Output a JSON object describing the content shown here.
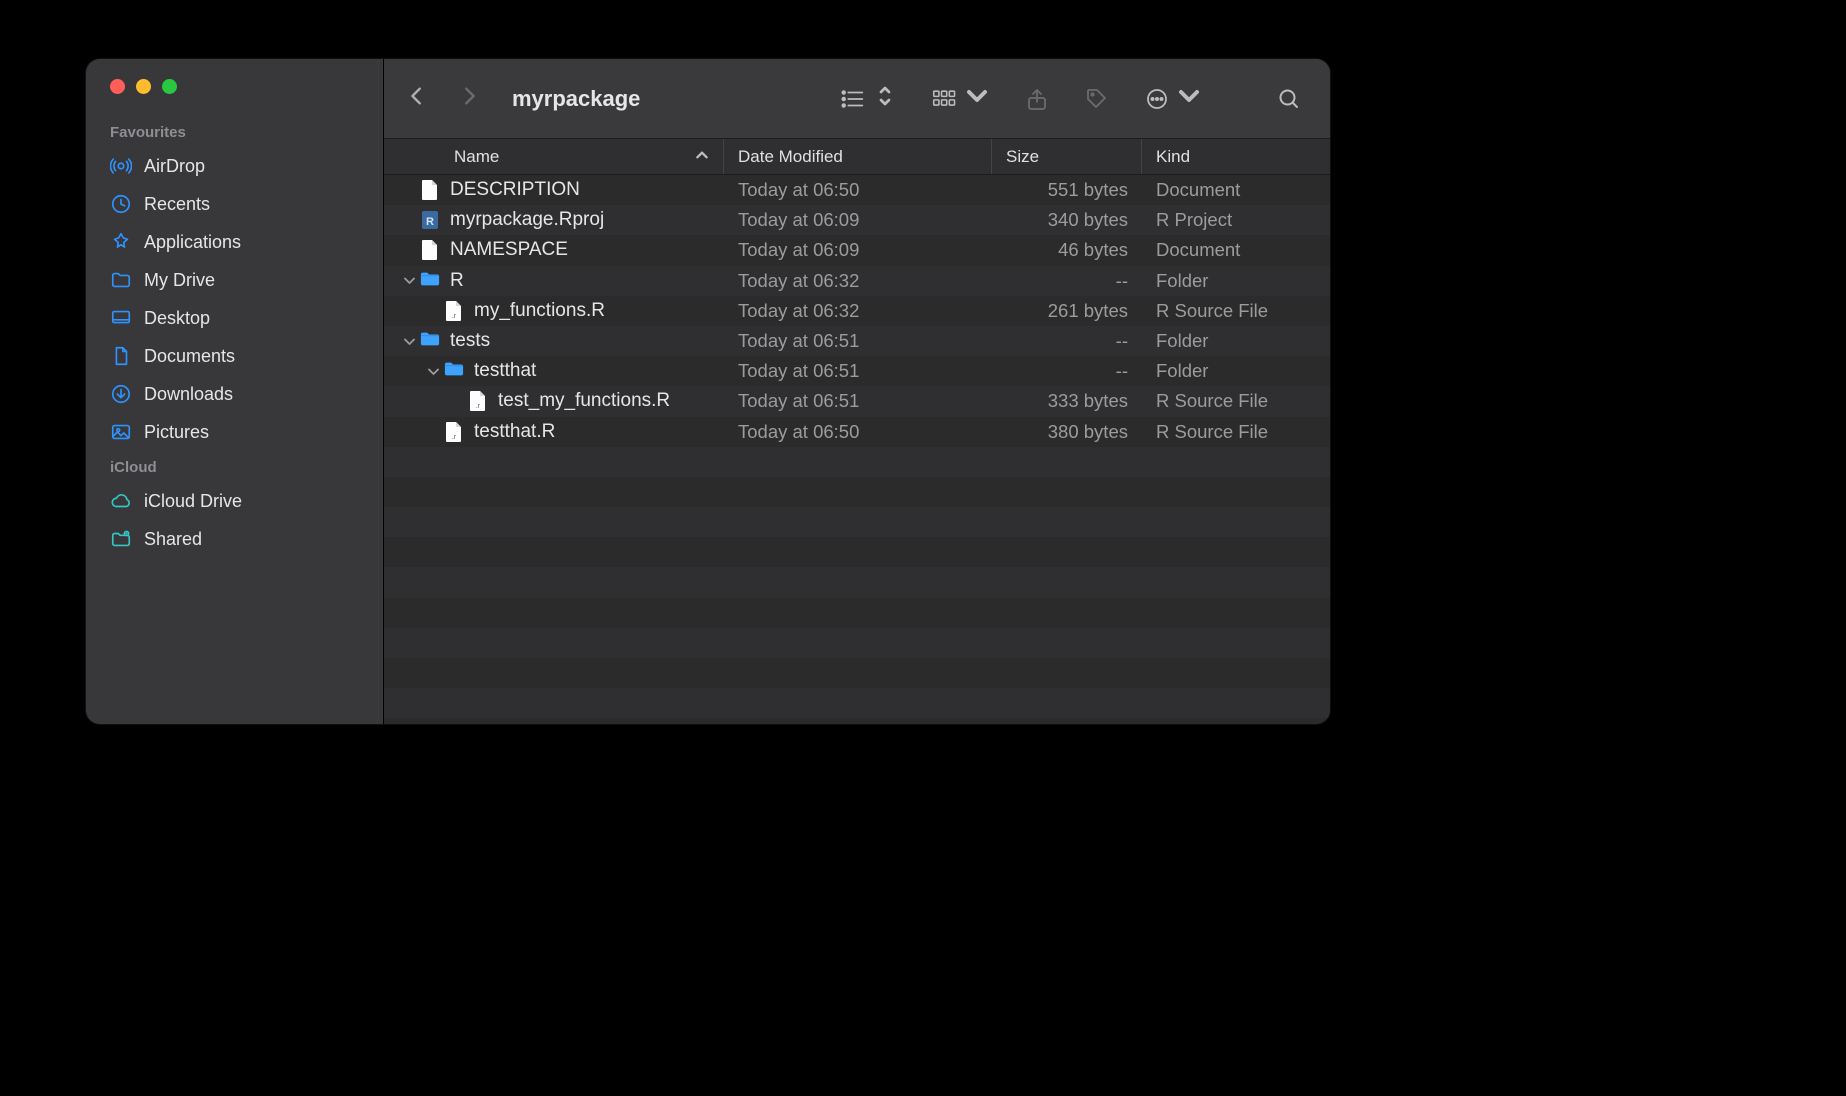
{
  "window": {
    "title": "myrpackage"
  },
  "sidebar": {
    "sections": [
      {
        "title": "Favourites",
        "items": [
          {
            "label": "AirDrop",
            "icon": "airdrop"
          },
          {
            "label": "Recents",
            "icon": "clock"
          },
          {
            "label": "Applications",
            "icon": "apps"
          },
          {
            "label": "My Drive",
            "icon": "folder"
          },
          {
            "label": "Desktop",
            "icon": "desktop"
          },
          {
            "label": "Documents",
            "icon": "document"
          },
          {
            "label": "Downloads",
            "icon": "download"
          },
          {
            "label": "Pictures",
            "icon": "pictures"
          }
        ]
      },
      {
        "title": "iCloud",
        "items": [
          {
            "label": "iCloud Drive",
            "icon": "cloud"
          },
          {
            "label": "Shared",
            "icon": "shared"
          }
        ]
      }
    ]
  },
  "columns": {
    "name": "Name",
    "date": "Date Modified",
    "size": "Size",
    "kind": "Kind"
  },
  "files": [
    {
      "indent": 0,
      "disclosure": "none",
      "icon": "doc",
      "name": "DESCRIPTION",
      "date": "Today at 06:50",
      "size": "551 bytes",
      "kind": "Document"
    },
    {
      "indent": 0,
      "disclosure": "none",
      "icon": "rproj",
      "name": "myrpackage.Rproj",
      "date": "Today at 06:09",
      "size": "340 bytes",
      "kind": "R Project"
    },
    {
      "indent": 0,
      "disclosure": "none",
      "icon": "doc",
      "name": "NAMESPACE",
      "date": "Today at 06:09",
      "size": "46 bytes",
      "kind": "Document"
    },
    {
      "indent": 0,
      "disclosure": "open",
      "icon": "folder",
      "name": "R",
      "date": "Today at 06:32",
      "size": "--",
      "kind": "Folder"
    },
    {
      "indent": 1,
      "disclosure": "none",
      "icon": "rsrc",
      "name": "my_functions.R",
      "date": "Today at 06:32",
      "size": "261 bytes",
      "kind": "R Source File"
    },
    {
      "indent": 0,
      "disclosure": "open",
      "icon": "folder",
      "name": "tests",
      "date": "Today at 06:51",
      "size": "--",
      "kind": "Folder"
    },
    {
      "indent": 1,
      "disclosure": "open",
      "icon": "folder",
      "name": "testthat",
      "date": "Today at 06:51",
      "size": "--",
      "kind": "Folder"
    },
    {
      "indent": 2,
      "disclosure": "none",
      "icon": "rsrc",
      "name": "test_my_functions.R",
      "date": "Today at 06:51",
      "size": "333 bytes",
      "kind": "R Source File"
    },
    {
      "indent": 1,
      "disclosure": "none",
      "icon": "rsrc",
      "name": "testthat.R",
      "date": "Today at 06:50",
      "size": "380 bytes",
      "kind": "R Source File"
    }
  ]
}
